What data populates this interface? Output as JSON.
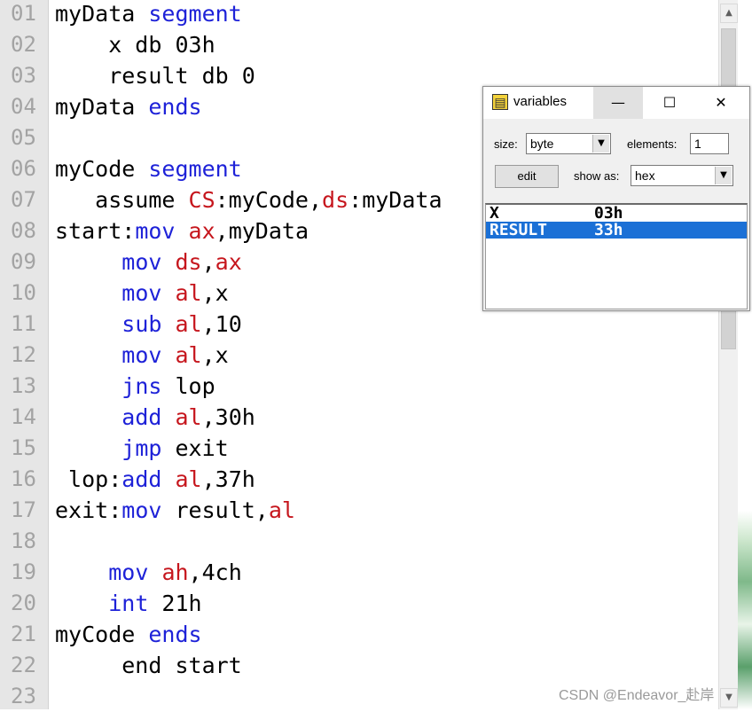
{
  "editor": {
    "line_numbers": [
      "01",
      "02",
      "03",
      "04",
      "05",
      "06",
      "07",
      "08",
      "09",
      "10",
      "11",
      "12",
      "13",
      "14",
      "15",
      "16",
      "17",
      "18",
      "19",
      "20",
      "21",
      "22",
      "23"
    ],
    "lines": [
      [
        {
          "t": "myData ",
          "c": "n"
        },
        {
          "t": "segment",
          "c": "kw"
        }
      ],
      [
        {
          "t": "    x db 03h",
          "c": "n"
        }
      ],
      [
        {
          "t": "    result db 0",
          "c": "n"
        }
      ],
      [
        {
          "t": "myData ",
          "c": "n"
        },
        {
          "t": "ends",
          "c": "kw"
        }
      ],
      [],
      [
        {
          "t": "myCode ",
          "c": "n"
        },
        {
          "t": "segment",
          "c": "kw"
        }
      ],
      [
        {
          "t": "   assume ",
          "c": "n"
        },
        {
          "t": "CS",
          "c": "reg"
        },
        {
          "t": ":myCode,",
          "c": "n"
        },
        {
          "t": "ds",
          "c": "reg"
        },
        {
          "t": ":myData",
          "c": "n"
        }
      ],
      [
        {
          "t": "start:",
          "c": "n"
        },
        {
          "t": "mov",
          "c": "kw"
        },
        {
          "t": " ",
          "c": "n"
        },
        {
          "t": "ax",
          "c": "reg"
        },
        {
          "t": ",myData",
          "c": "n"
        }
      ],
      [
        {
          "t": "     ",
          "c": "n"
        },
        {
          "t": "mov",
          "c": "kw"
        },
        {
          "t": " ",
          "c": "n"
        },
        {
          "t": "ds",
          "c": "reg"
        },
        {
          "t": ",",
          "c": "n"
        },
        {
          "t": "ax",
          "c": "reg"
        }
      ],
      [
        {
          "t": "     ",
          "c": "n"
        },
        {
          "t": "mov",
          "c": "kw"
        },
        {
          "t": " ",
          "c": "n"
        },
        {
          "t": "al",
          "c": "reg"
        },
        {
          "t": ",x",
          "c": "n"
        }
      ],
      [
        {
          "t": "     ",
          "c": "n"
        },
        {
          "t": "sub",
          "c": "kw"
        },
        {
          "t": " ",
          "c": "n"
        },
        {
          "t": "al",
          "c": "reg"
        },
        {
          "t": ",10",
          "c": "n"
        }
      ],
      [
        {
          "t": "     ",
          "c": "n"
        },
        {
          "t": "mov",
          "c": "kw"
        },
        {
          "t": " ",
          "c": "n"
        },
        {
          "t": "al",
          "c": "reg"
        },
        {
          "t": ",x",
          "c": "n"
        }
      ],
      [
        {
          "t": "     ",
          "c": "n"
        },
        {
          "t": "jns",
          "c": "kw"
        },
        {
          "t": " lop",
          "c": "n"
        }
      ],
      [
        {
          "t": "     ",
          "c": "n"
        },
        {
          "t": "add",
          "c": "kw"
        },
        {
          "t": " ",
          "c": "n"
        },
        {
          "t": "al",
          "c": "reg"
        },
        {
          "t": ",30h",
          "c": "n"
        }
      ],
      [
        {
          "t": "     ",
          "c": "n"
        },
        {
          "t": "jmp",
          "c": "kw"
        },
        {
          "t": " exit",
          "c": "n"
        }
      ],
      [
        {
          "t": " lop:",
          "c": "n"
        },
        {
          "t": "add",
          "c": "kw"
        },
        {
          "t": " ",
          "c": "n"
        },
        {
          "t": "al",
          "c": "reg"
        },
        {
          "t": ",37h",
          "c": "n"
        }
      ],
      [
        {
          "t": "exit:",
          "c": "n"
        },
        {
          "t": "mov",
          "c": "kw"
        },
        {
          "t": " result,",
          "c": "n"
        },
        {
          "t": "al",
          "c": "reg"
        }
      ],
      [],
      [
        {
          "t": "    ",
          "c": "n"
        },
        {
          "t": "mov",
          "c": "kw"
        },
        {
          "t": " ",
          "c": "n"
        },
        {
          "t": "ah",
          "c": "reg"
        },
        {
          "t": ",4ch",
          "c": "n"
        }
      ],
      [
        {
          "t": "    ",
          "c": "n"
        },
        {
          "t": "int",
          "c": "kw"
        },
        {
          "t": " 21h",
          "c": "n"
        }
      ],
      [
        {
          "t": "myCode ",
          "c": "n"
        },
        {
          "t": "ends",
          "c": "kw"
        }
      ],
      [
        {
          "t": "     end start",
          "c": "n"
        }
      ],
      []
    ],
    "colors": {
      "keyword": "#1e22d8",
      "register": "#c6161d",
      "line_number": "#a3a3a3"
    }
  },
  "scrollbar": {
    "up_icon": "▲",
    "down_icon": "▼"
  },
  "variables_window": {
    "title": "variables",
    "title_icon": "table-icon",
    "min_label": "—",
    "max_label": "☐",
    "close_label": "✕",
    "size_label": "size:",
    "size_value": "byte",
    "elements_label": "elements:",
    "elements_value": "1",
    "edit_label": "edit",
    "show_as_label": "show as:",
    "show_as_value": "hex",
    "dropdown_icon": "▼",
    "rows": [
      {
        "name": "X",
        "value": "03h",
        "selected": false
      },
      {
        "name": "RESULT",
        "value": "33h",
        "selected": true
      }
    ],
    "selected_color": "#1b70d6"
  },
  "watermark": "CSDN @Endeavor_赴岸"
}
